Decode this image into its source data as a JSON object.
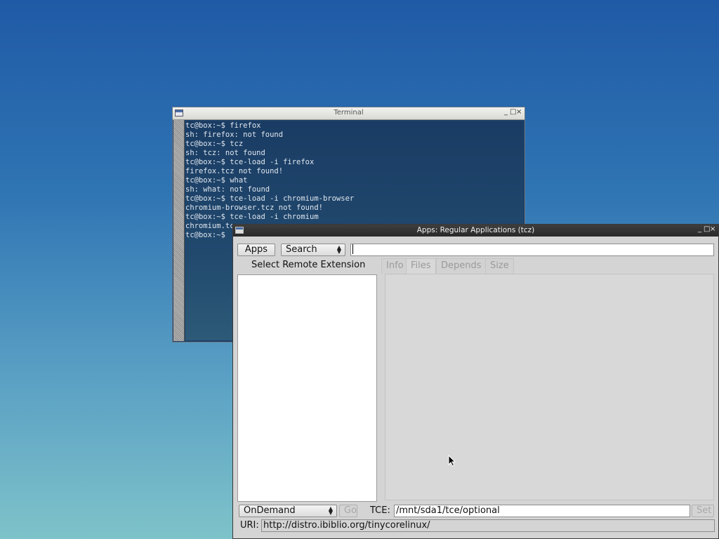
{
  "terminal": {
    "title": "Terminal",
    "controls": [
      "_",
      "□",
      "×"
    ],
    "lines": [
      "tc@box:~$ firefox",
      "sh: firefox: not found",
      "tc@box:~$ tcz",
      "sh: tcz: not found",
      "tc@box:~$ tce-load -i firefox",
      "firefox.tcz not found!",
      "tc@box:~$ what",
      "sh: what: not found",
      "tc@box:~$ tce-load -i chromium-browser",
      "chromium-browser.tcz not found!",
      "tc@box:~$ tce-load -i chromium",
      "chromium.tc",
      "tc@box:~$ "
    ]
  },
  "apps": {
    "title": "Apps: Regular Applications (tcz)",
    "controls": [
      "_",
      "□",
      "×"
    ],
    "apps_button": "Apps",
    "search_select": "Search",
    "search_value": "",
    "list_header": "Select Remote Extension",
    "tabs": [
      "Info",
      "Files",
      "Depends",
      "Size"
    ],
    "mode_select": "OnDemand",
    "go_button": "Go",
    "tce_label": "TCE:",
    "tce_value": "/mnt/sda1/tce/optional",
    "set_button": "Set",
    "uri_label": "URI:",
    "uri_value": "http://distro.ibiblio.org/tinycorelinux/"
  },
  "colors": {
    "desktop_top": "#1f5aa6",
    "desktop_bottom": "#7ec3c9",
    "terminal_bg": "#1d4066",
    "window_bg": "#d4d4d4"
  }
}
